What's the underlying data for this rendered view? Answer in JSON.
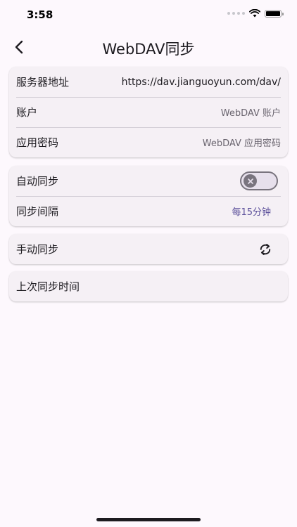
{
  "status_bar": {
    "time": "3:58"
  },
  "header": {
    "title": "WebDAV同步",
    "back_icon": "chevron-left-icon"
  },
  "server_card": {
    "server_address_label": "服务器地址",
    "server_address_value": "https://dav.jianguoyun.com/dav/",
    "account_label": "账户",
    "account_placeholder": "WebDAV 账户",
    "app_password_label": "应用密码",
    "app_password_placeholder": "WebDAV 应用密码"
  },
  "auto_sync_card": {
    "auto_sync_label": "自动同步",
    "auto_sync_enabled": false,
    "interval_label": "同步间隔",
    "interval_value": "每15分钟"
  },
  "manual_sync_card": {
    "label": "手动同步",
    "icon": "sync-icon"
  },
  "last_sync_card": {
    "label": "上次同步时间"
  },
  "colors": {
    "background": "#fdf8fd",
    "card": "#f5f0f5",
    "accent": "#5b4f9a",
    "divider": "#d3ced6"
  }
}
